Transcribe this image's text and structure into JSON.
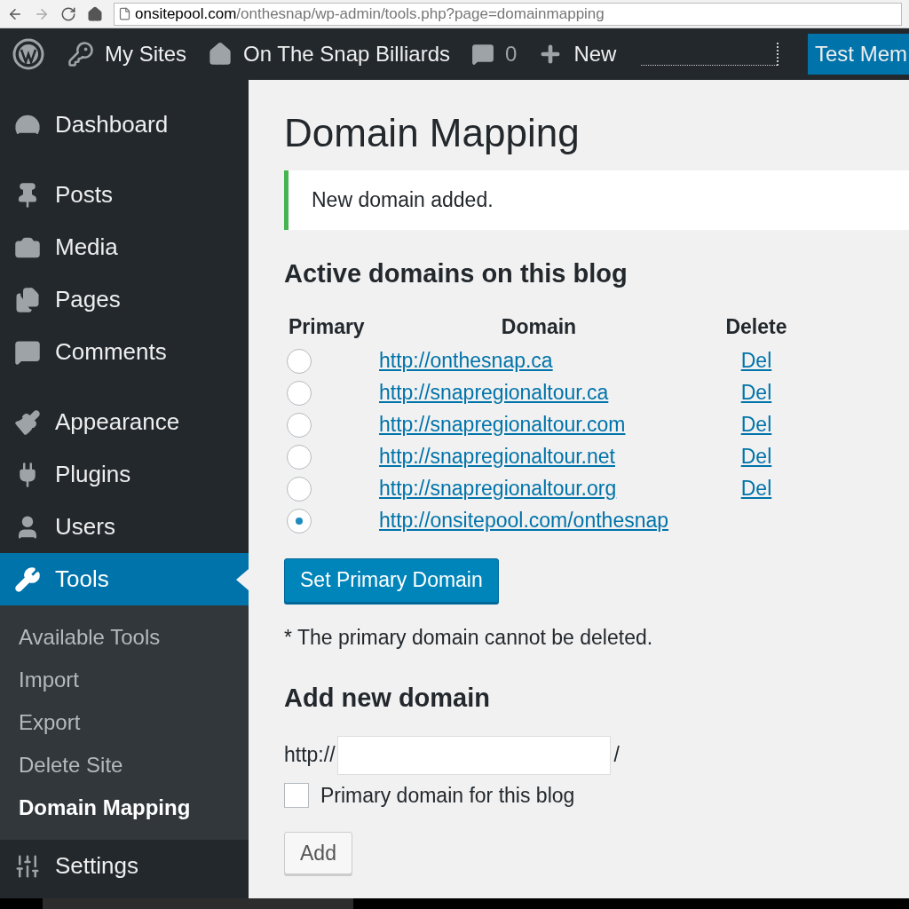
{
  "browser": {
    "url_host": "onsitepool.com",
    "url_path": "/onthesnap/wp-admin/tools.php?page=domainmapping"
  },
  "admin_bar": {
    "my_sites": "My Sites",
    "site_name": "On The Snap Billiards",
    "comments": "0",
    "new": "New",
    "account": "Test Mem"
  },
  "sidebar": {
    "groups": [
      [
        {
          "label": "Dashboard",
          "selected": false
        }
      ],
      [
        {
          "label": "Posts",
          "selected": false
        },
        {
          "label": "Media",
          "selected": false
        },
        {
          "label": "Pages",
          "selected": false
        },
        {
          "label": "Comments",
          "selected": false
        }
      ],
      [
        {
          "label": "Appearance",
          "selected": false
        },
        {
          "label": "Plugins",
          "selected": false
        },
        {
          "label": "Users",
          "selected": false
        },
        {
          "label": "Tools",
          "selected": true
        }
      ]
    ],
    "submenu": [
      {
        "label": "Available Tools",
        "selected": false
      },
      {
        "label": "Import",
        "selected": false
      },
      {
        "label": "Export",
        "selected": false
      },
      {
        "label": "Delete Site",
        "selected": false
      },
      {
        "label": "Domain Mapping",
        "selected": true
      }
    ],
    "after": [
      {
        "label": "Settings",
        "selected": false
      }
    ]
  },
  "page": {
    "title": "Domain Mapping",
    "notice": "New domain added.",
    "active_heading": "Active domains on this blog",
    "columns": [
      "Primary",
      "Domain",
      "Delete"
    ],
    "domains": [
      {
        "url": "http://onthesnap.ca",
        "selected": false,
        "delete": "Del"
      },
      {
        "url": "http://snapregionaltour.ca",
        "selected": false,
        "delete": "Del"
      },
      {
        "url": "http://snapregionaltour.com",
        "selected": false,
        "delete": "Del"
      },
      {
        "url": "http://snapregionaltour.net",
        "selected": false,
        "delete": "Del"
      },
      {
        "url": "http://snapregionaltour.org",
        "selected": false,
        "delete": "Del"
      },
      {
        "url": "http://onsitepool.com/onthesnap",
        "selected": true
      }
    ],
    "set_primary": "Set Primary Domain",
    "note": "* The primary domain cannot be deleted.",
    "add_heading": "Add new domain",
    "prefix": "http://",
    "suffix": "/",
    "primary_checkbox": {
      "label": "Primary domain for this blog",
      "checked": false
    },
    "add_button": "Add"
  }
}
